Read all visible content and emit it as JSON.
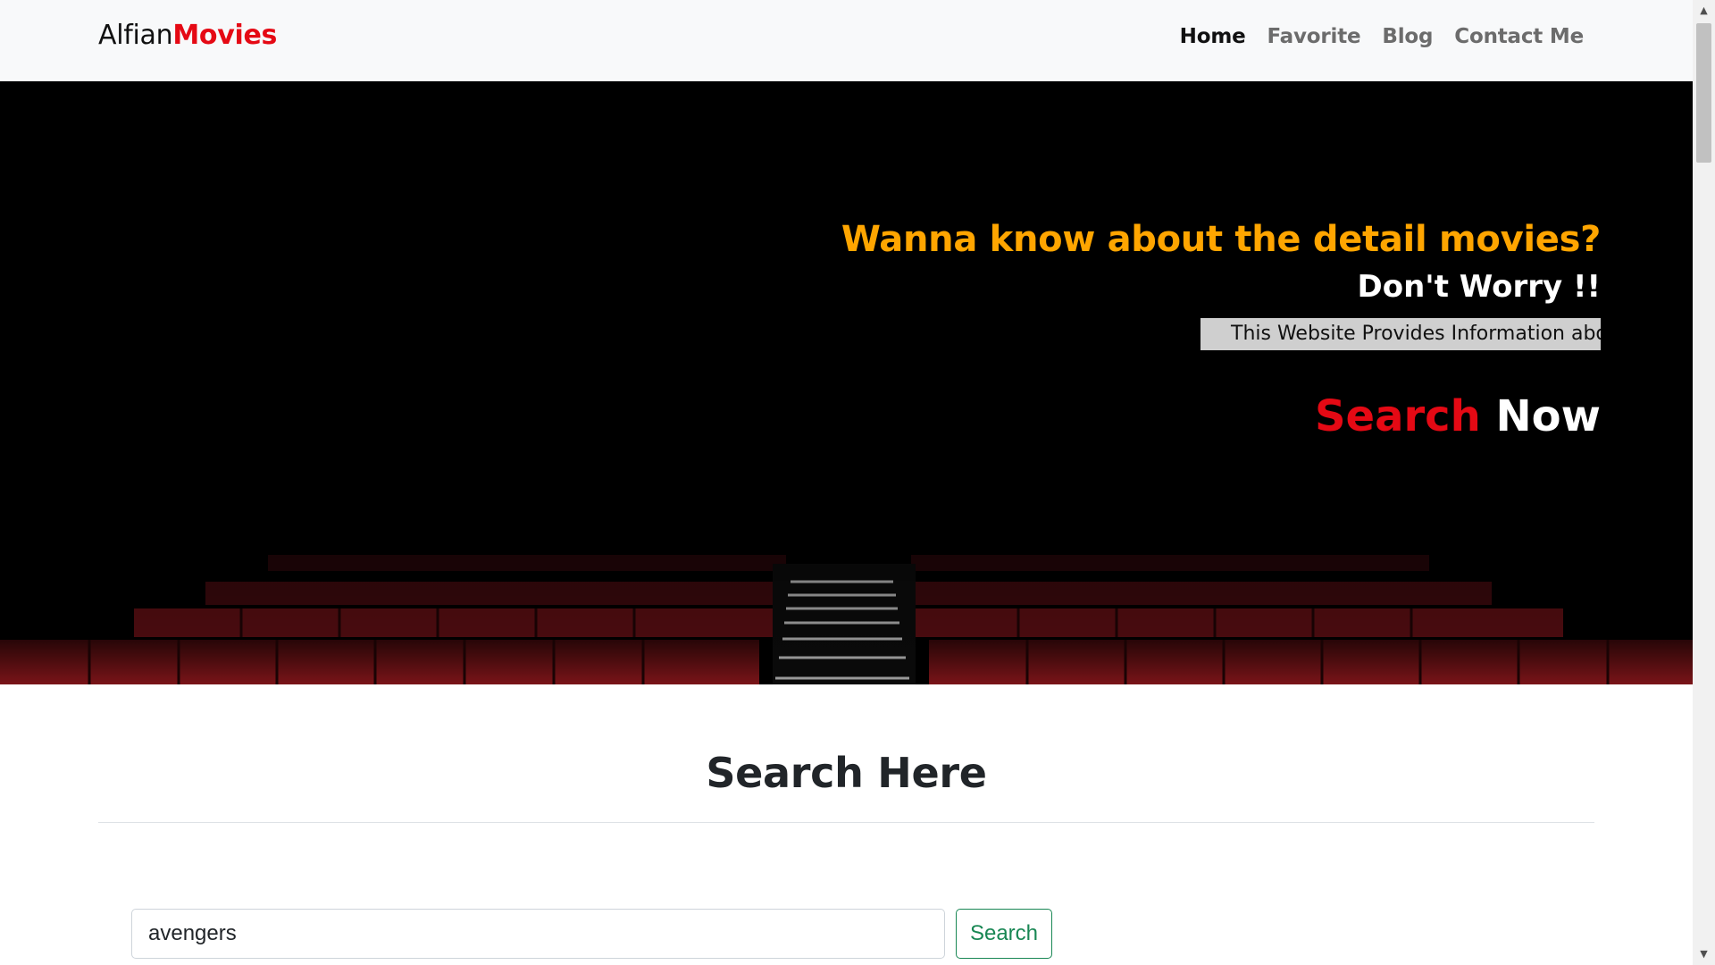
{
  "navbar": {
    "brand_part1": "Alfian",
    "brand_part2": "Movies",
    "links": [
      {
        "label": "Home",
        "active": true
      },
      {
        "label": "Favorite",
        "active": false
      },
      {
        "label": "Blog",
        "active": false
      },
      {
        "label": "Contact Me",
        "active": false
      }
    ]
  },
  "hero": {
    "question": "Wanna know about the detail movies?",
    "worry": "Don't Worry !!",
    "marquee": "This Website Provides Information abo",
    "cta_red": "Search",
    "cta_white": "Now"
  },
  "search_section": {
    "title": "Search Here",
    "input_value": "avengers",
    "button_label": "Search"
  },
  "colors": {
    "brand_red": "#e50914",
    "question_orange": "#ffa500",
    "button_green": "#198754",
    "seat_red": "#6b0f12"
  },
  "icons": {
    "scroll_up": "triangle-up-icon",
    "scroll_down": "triangle-down-icon"
  }
}
